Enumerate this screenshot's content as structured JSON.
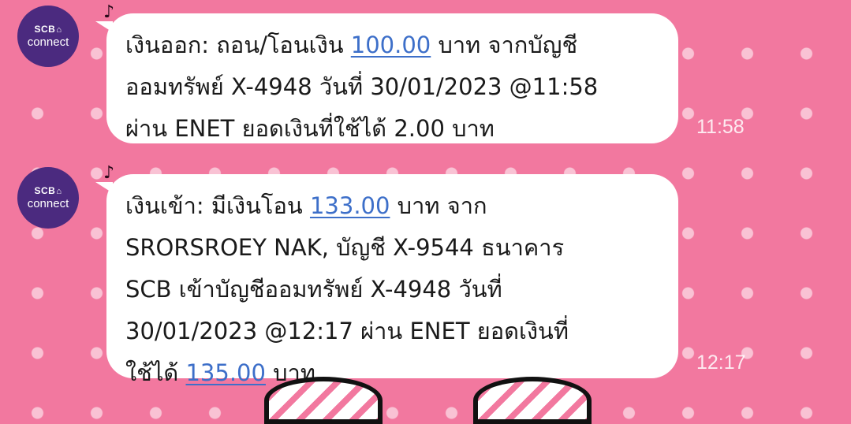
{
  "messages": [
    {
      "avatar": {
        "brand": "SCB",
        "logo_icon": "home-outline-icon",
        "label": "connect"
      },
      "icon": "music-note-icon",
      "lines": [
        {
          "pre": "เงินออก: ถอน/โอนเงิน ",
          "amount": "100.00",
          "post": " บาท จากบัญชี"
        },
        {
          "pre": "ออมทรัพย์ X-4948 วันที่ 30/01/2023 @11:58"
        },
        {
          "pre": "ผ่าน ENET ยอดเงินที่ใช้ได้ 2.00 บาท"
        }
      ],
      "time": "11:58"
    },
    {
      "avatar": {
        "brand": "SCB",
        "logo_icon": "home-outline-icon",
        "label": "connect"
      },
      "icon": "music-note-icon",
      "lines": [
        {
          "pre": "เงินเข้า: มีเงินโอน ",
          "amount": "133.00",
          "post": " บาท จาก"
        },
        {
          "pre": "SRORSROEY NAK, บัญชี X-9544 ธนาคาร"
        },
        {
          "pre": "SCB เข้าบัญชีออมทรัพย์ X-4948 วันที่"
        },
        {
          "pre": "30/01/2023 @12:17 ผ่าน ENET ยอดเงินที่"
        },
        {
          "pre": "ใช้ได้ ",
          "amount": "135.00",
          "post": " บาท"
        }
      ],
      "time": "12:17"
    }
  ],
  "colors": {
    "background": "#f2789f",
    "avatar": "#4b2a7f",
    "link": "#3d6fc9"
  }
}
